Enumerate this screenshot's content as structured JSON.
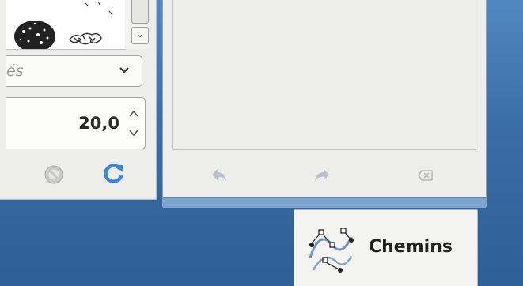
{
  "brushes": {
    "scroll_down_label": "⌄"
  },
  "tool_options": {
    "dropdown_text": "és",
    "size_value": "20,0"
  },
  "actions": {
    "reset_icon": "circle-slash-icon",
    "refresh_icon": "refresh-icon"
  },
  "paths_panel": {
    "undo_icon": "undo-icon",
    "redo_icon": "redo-icon",
    "clear_icon": "clear-icon"
  },
  "tab": {
    "label": "Chemins",
    "icon": "paths-icon"
  },
  "colors": {
    "panel_bg": "#ededec",
    "accent_blue": "#3a86d6",
    "desktop_blue": "#3a6ea5",
    "selection_bar": "#7fa5cf"
  }
}
